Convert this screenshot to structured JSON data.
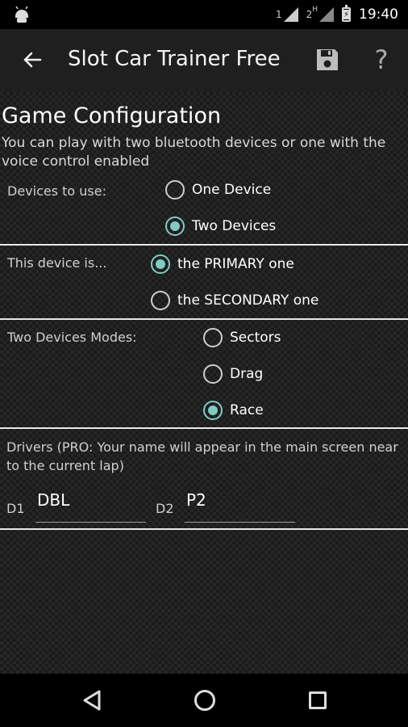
{
  "status_bar": {
    "sim1_label": "1",
    "sim2_label": "2",
    "sim2_network": "H",
    "time": "19:40"
  },
  "app_bar": {
    "title": "Slot Car Trainer Free",
    "help_glyph": "?"
  },
  "config": {
    "heading": "Game Configuration",
    "description": "You can play with two bluetooth devices or one with the voice control enabled",
    "devices": {
      "label": "Devices to use:",
      "options": [
        "One Device",
        "Two Devices"
      ],
      "selected": "Two Devices"
    },
    "role": {
      "label": "This device is...",
      "options": [
        "the PRIMARY one",
        "the SECONDARY one"
      ],
      "selected": "the PRIMARY one"
    },
    "modes": {
      "label": "Two Devices Modes:",
      "options": [
        "Sectors",
        "Drag",
        "Race"
      ],
      "selected": "Race"
    },
    "drivers": {
      "label": "Drivers (PRO: Your name will appear in the main screen near to the current lap)",
      "d1_label": "D1",
      "d1_value": "DBL",
      "d2_label": "D2",
      "d2_value": "P2"
    }
  },
  "colors": {
    "accent": "#80cbc4",
    "appbar": "#1f1f1f",
    "background": "#262626"
  }
}
